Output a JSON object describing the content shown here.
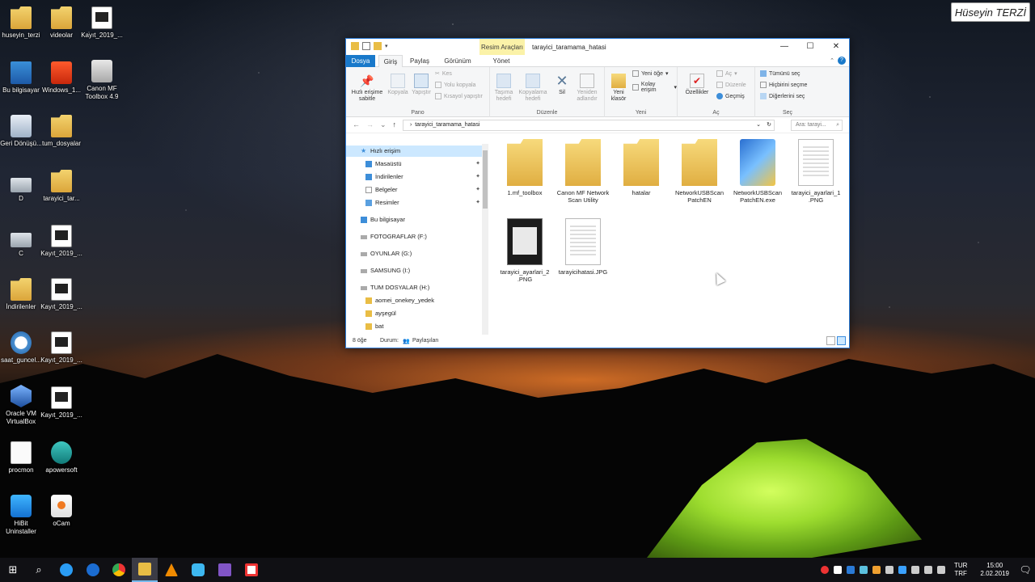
{
  "watermark": "Hüseyin TERZİ",
  "desktop": {
    "icons_col1": [
      {
        "label": "huseyin_terzi",
        "icon": "user-folder-icon"
      },
      {
        "label": "Bu bilgisayar",
        "icon": "this-pc-icon"
      },
      {
        "label": "Geri Dönüşü...",
        "icon": "recycle-bin-icon"
      },
      {
        "label": "D",
        "icon": "drive-icon"
      },
      {
        "label": "C",
        "icon": "windows-drive-icon"
      },
      {
        "label": "İndirilenler",
        "icon": "downloads-icon"
      },
      {
        "label": "saat_guncel...",
        "icon": "clock-app-icon"
      },
      {
        "label": "Oracle VM VirtualBox",
        "icon": "virtualbox-icon"
      },
      {
        "label": "procmon",
        "icon": "document-icon"
      },
      {
        "label": "HiBit Uninstaller",
        "icon": "hibit-icon"
      }
    ],
    "icons_col2": [
      {
        "label": "videolar",
        "icon": "folder-icon"
      },
      {
        "label": "Windows_1...",
        "icon": "office-icon"
      },
      {
        "label": "tum_dosyalar",
        "icon": "folder-icon"
      },
      {
        "label": "tarayici_tar...",
        "icon": "folder-icon"
      },
      {
        "label": "Kayıt_2019_...",
        "icon": "video-file-icon"
      },
      {
        "label": "Kayıt_2019_...",
        "icon": "video-file-icon"
      },
      {
        "label": "Kayıt_2019_...",
        "icon": "video-file-icon"
      },
      {
        "label": "Kayıt_2019_...",
        "icon": "video-file-icon"
      },
      {
        "label": "apowersoft",
        "icon": "apowersoft-icon"
      },
      {
        "label": "oCam",
        "icon": "ocam-icon"
      }
    ],
    "icons_col3": [
      {
        "label": "Kayıt_2019_...",
        "icon": "video-file-icon"
      },
      {
        "label": "Canon MF Toolbox 4.9",
        "icon": "printer-icon"
      }
    ]
  },
  "explorer": {
    "context_tab": "Resim Araçları",
    "title": "tarayici_taramama_hatasi",
    "tabs": [
      "Dosya",
      "Giriş",
      "Paylaş",
      "Görünüm",
      "Yönet"
    ],
    "ribbon": {
      "pano": {
        "label": "Pano",
        "pin": "Hızlı erişime sabitle",
        "copy": "Kopyala",
        "paste": "Yapıştır",
        "cut": "Kes",
        "copy_path": "Yolu kopyala",
        "paste_shortcut": "Kısayol yapıştır"
      },
      "duzenle": {
        "label": "Düzenle",
        "move": "Taşıma hedefi",
        "copyto": "Kopyalama hedefi",
        "delete": "Sil",
        "rename": "Yeniden adlandır"
      },
      "yeni": {
        "label": "Yeni",
        "new_folder": "Yeni klasör",
        "new_item": "Yeni öğe",
        "easy_access": "Kolay erişim"
      },
      "ac": {
        "label": "Aç",
        "properties": "Özellikler",
        "open": "Aç",
        "edit": "Düzenle",
        "history": "Geçmiş"
      },
      "sec": {
        "label": "Seç",
        "select_all": "Tümünü seç",
        "select_none": "Hiçbirini seçme",
        "invert": "Diğerlerini seç"
      }
    },
    "address": "tarayici_taramama_hatasi",
    "search_placeholder": "Ara: tarayi...",
    "nav": [
      {
        "label": "Hızlı erişim",
        "selected": true,
        "pinned": false
      },
      {
        "label": "Masaüstü",
        "selected": false,
        "pinned": true
      },
      {
        "label": "İndirilenler",
        "selected": false,
        "pinned": true
      },
      {
        "label": "Belgeler",
        "selected": false,
        "pinned": true
      },
      {
        "label": "Resimler",
        "selected": false,
        "pinned": true
      },
      {
        "label": "Bu bilgisayar",
        "selected": false,
        "pinned": false
      },
      {
        "label": "FOTOGRAFLAR (F:)",
        "selected": false,
        "pinned": false
      },
      {
        "label": "OYUNLAR (G:)",
        "selected": false,
        "pinned": false
      },
      {
        "label": "SAMSUNG (I:)",
        "selected": false,
        "pinned": false
      },
      {
        "label": "TUM DOSYALAR (H:)",
        "selected": false,
        "pinned": false
      },
      {
        "label": "aomei_onekey_yedek",
        "selected": false,
        "pinned": false
      },
      {
        "label": "ayşegül",
        "selected": false,
        "pinned": false
      },
      {
        "label": "bat",
        "selected": false,
        "pinned": false
      }
    ],
    "files": [
      {
        "name": "1.mf_toolbox",
        "type": "folder"
      },
      {
        "name": "Canon MF Network Scan Utility",
        "type": "folder"
      },
      {
        "name": "hatalar",
        "type": "folder"
      },
      {
        "name": "NetworkUSBScan PatchEN",
        "type": "folder"
      },
      {
        "name": "NetworkUSBScan PatchEN.exe",
        "type": "exe"
      },
      {
        "name": "tarayici_ayarlari_1 .PNG",
        "type": "png"
      },
      {
        "name": "tarayici_ayarlari_2 .PNG",
        "type": "dark"
      },
      {
        "name": "tarayicihatasi.JPG",
        "type": "png"
      }
    ],
    "status": {
      "count": "8 öğe",
      "state_label": "Durum:",
      "state_value": "Paylaşılan"
    }
  },
  "taskbar": {
    "lang_top": "TUR",
    "lang_bottom": "TRF",
    "time": "15:00",
    "date": "2.02.2019"
  },
  "colors": {
    "accent": "#1979ca",
    "context_tab": "#fbf2a8",
    "selection": "#cce8ff"
  }
}
